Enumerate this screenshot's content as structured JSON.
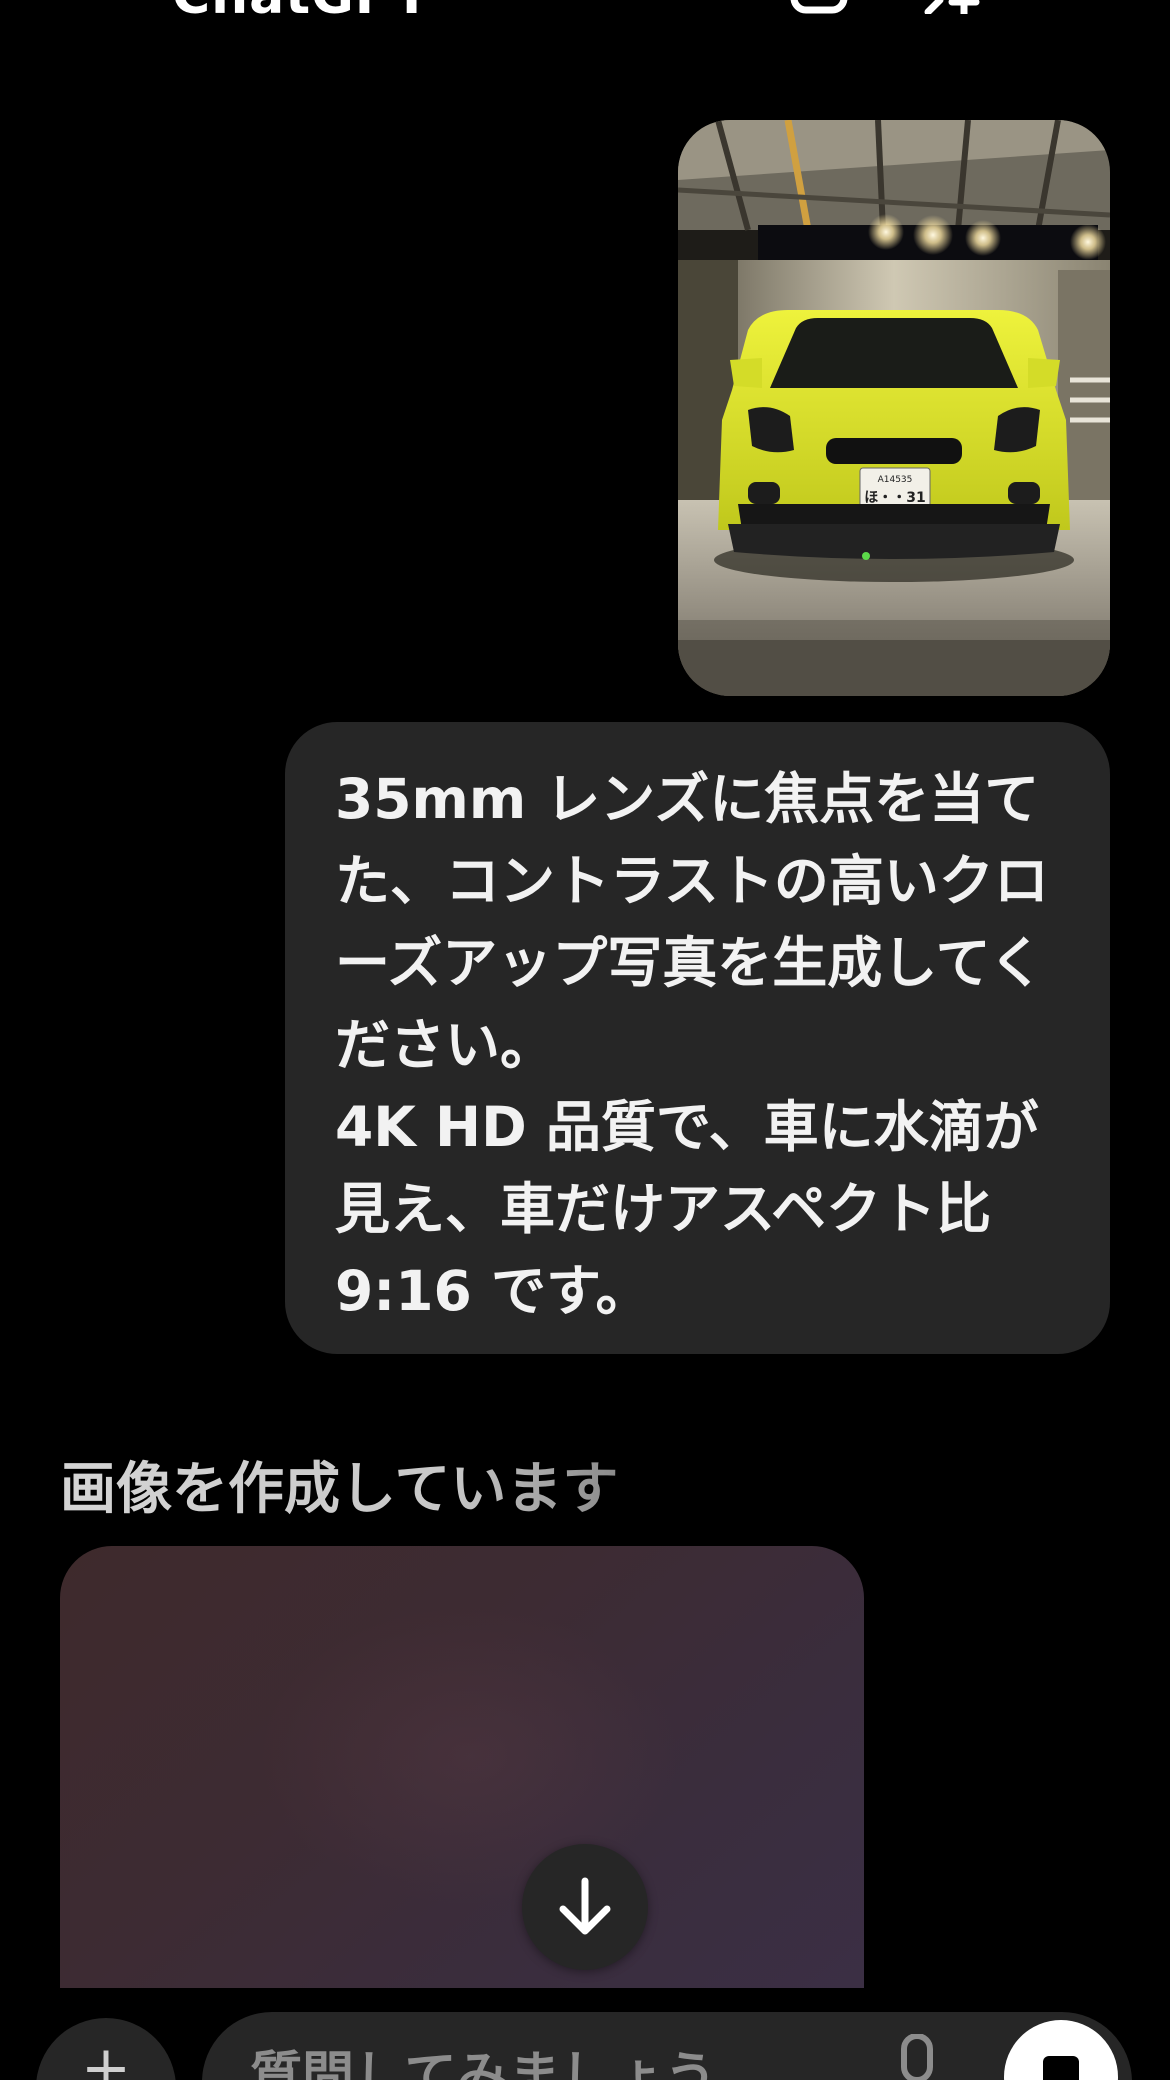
{
  "header": {
    "title": "ChatGPT",
    "icons": [
      "new-chat-icon",
      "new-group-chat-icon"
    ]
  },
  "messages": {
    "user_image": {
      "subject": "yellow-hatchback-car-photo",
      "plate_top": "A14535",
      "plate_bottom": "ほ・・31"
    },
    "user_text": "35mm レンズに焦点を当てた、コントラストの高いクローズアップ写真を生成してください。\n4K HD 品質で、車に水滴が見え、車だけアスペクト比 9:16 です。",
    "assistant_status": "画像を作成しています"
  },
  "composer": {
    "placeholder": "質問してみましょう",
    "plus_icon": "plus-icon",
    "mic_icon": "mic-icon",
    "stop_icon": "stop-icon"
  },
  "colors": {
    "background": "#000000",
    "bubble": "#262626",
    "text": "#f2f2f2",
    "status_text": "#cccccc",
    "placeholder_gradient_start": "#3e2a2c",
    "placeholder_gradient_end": "#3b2f45",
    "car_yellow": "#d8e02a"
  }
}
